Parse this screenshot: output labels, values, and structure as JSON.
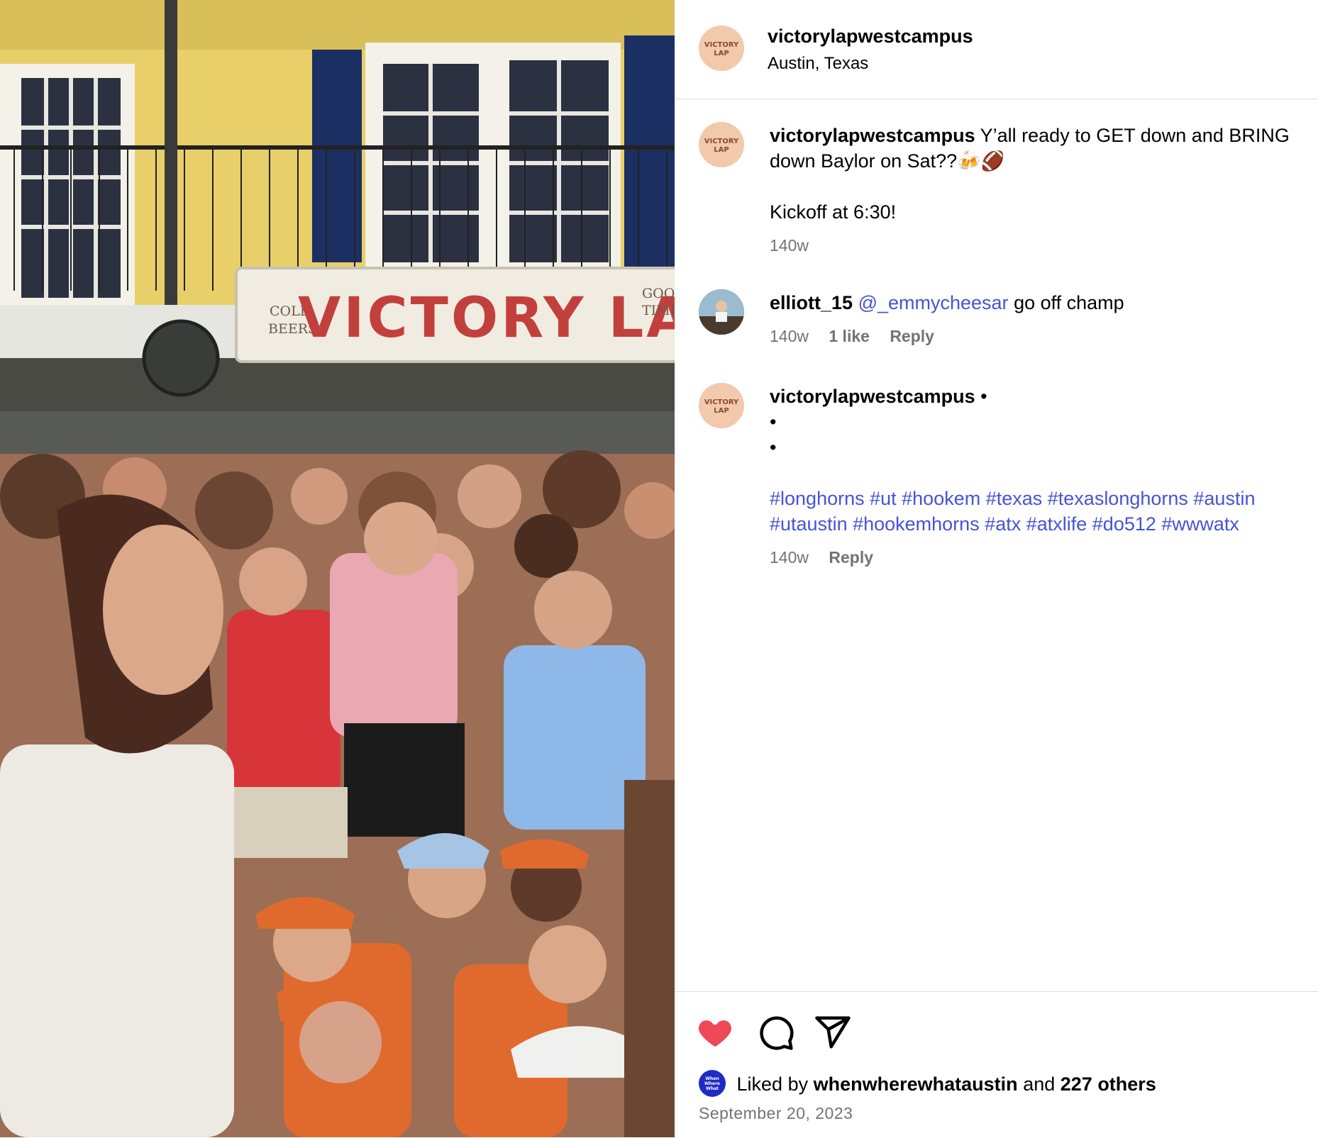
{
  "post": {
    "author": "victorylapwestcampus",
    "location": "Austin, Texas",
    "photo_sign": {
      "main": "VICTORY LAP",
      "left_top": "COLD",
      "left_bottom": "BEERS",
      "right_top": "GOO",
      "right_bottom": "TIME"
    },
    "avatar_logo": {
      "top": "VICTORY",
      "bottom": "LAP"
    }
  },
  "caption": {
    "author": "victorylapwestcampus",
    "text": "Y’all ready to GET down and BRING down Baylor on Sat??🍻🏈",
    "line2": "Kickoff at 6:30!",
    "time": "140w"
  },
  "comments": [
    {
      "author": "elliott_15",
      "mention": "@_emmycheesar",
      "text": "go off champ",
      "time": "140w",
      "likes": "1 like",
      "reply": "Reply"
    },
    {
      "author": "victorylapwestcampus",
      "dot": "•",
      "line1": "•",
      "line2": "•",
      "hashtags_1": "#longhorns #ut #hookem #texas #texaslonghorns #austin",
      "hashtags_2": "#utaustin #hookemhorns #atx #atxlife #do512 #wwwatx",
      "time": "140w",
      "reply": "Reply"
    }
  ],
  "actions": {
    "like_icon": "heart-icon",
    "like_color": "#ed4956",
    "comment_icon": "comment-icon",
    "share_icon": "send-icon"
  },
  "likes": {
    "prefix": "Liked by",
    "user": "whenwherewhataustin",
    "middle": "and",
    "others": "227 others",
    "mini_avatar_text": "When Where What"
  },
  "date": "September 20, 2023"
}
